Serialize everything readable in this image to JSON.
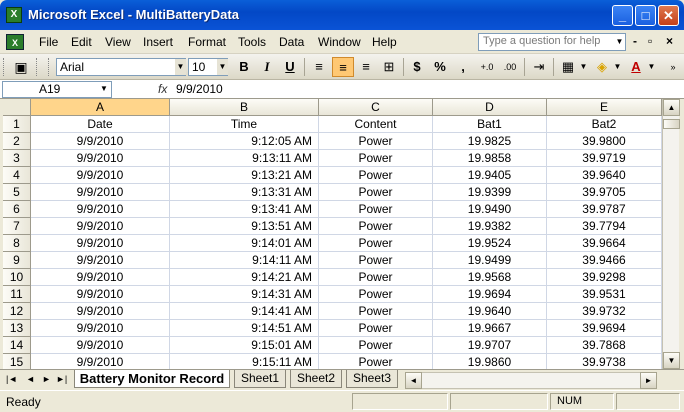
{
  "window": {
    "title": "Microsoft Excel - MultiBatteryData",
    "app_icon": "X",
    "min": "_",
    "max": "□",
    "close": "✕"
  },
  "menu": {
    "doc_icon": "X",
    "items": [
      "File",
      "Edit",
      "View",
      "Insert",
      "Format",
      "Tools",
      "Data",
      "Window",
      "Help"
    ],
    "help_placeholder": "Type a question for help",
    "doc_controls": [
      "-",
      "&#9645;",
      "×"
    ]
  },
  "toolbar": {
    "font": "Arial",
    "size": "10",
    "bold": "B",
    "italic": "I",
    "underline": "U",
    "currency": "$",
    "percent": "%",
    "comma": ",",
    "inc_decimal": "+.0",
    "dec_decimal": ".00",
    "font_color": "A"
  },
  "formula_bar": {
    "name_box": "A19",
    "fx": "fx",
    "value": "9/9/2010"
  },
  "sheet": {
    "columns": [
      "A",
      "B",
      "C",
      "D",
      "E"
    ],
    "selected_column": "A",
    "rows": [
      {
        "n": "1",
        "c": [
          "Date",
          "Time",
          "Content",
          "Bat1",
          "Bat2"
        ]
      },
      {
        "n": "2",
        "c": [
          "9/9/2010",
          "9:12:05 AM",
          "Power",
          "19.9825",
          "39.9800"
        ]
      },
      {
        "n": "3",
        "c": [
          "9/9/2010",
          "9:13:11 AM",
          "Power",
          "19.9858",
          "39.9719"
        ]
      },
      {
        "n": "4",
        "c": [
          "9/9/2010",
          "9:13:21 AM",
          "Power",
          "19.9405",
          "39.9640"
        ]
      },
      {
        "n": "5",
        "c": [
          "9/9/2010",
          "9:13:31 AM",
          "Power",
          "19.9399",
          "39.9705"
        ]
      },
      {
        "n": "6",
        "c": [
          "9/9/2010",
          "9:13:41 AM",
          "Power",
          "19.9490",
          "39.9787"
        ]
      },
      {
        "n": "7",
        "c": [
          "9/9/2010",
          "9:13:51 AM",
          "Power",
          "19.9382",
          "39.7794"
        ]
      },
      {
        "n": "8",
        "c": [
          "9/9/2010",
          "9:14:01 AM",
          "Power",
          "19.9524",
          "39.9664"
        ]
      },
      {
        "n": "9",
        "c": [
          "9/9/2010",
          "9:14:11 AM",
          "Power",
          "19.9499",
          "39.9466"
        ]
      },
      {
        "n": "10",
        "c": [
          "9/9/2010",
          "9:14:21 AM",
          "Power",
          "19.9568",
          "39.9298"
        ]
      },
      {
        "n": "11",
        "c": [
          "9/9/2010",
          "9:14:31 AM",
          "Power",
          "19.9694",
          "39.9531"
        ]
      },
      {
        "n": "12",
        "c": [
          "9/9/2010",
          "9:14:41 AM",
          "Power",
          "19.9640",
          "39.9732"
        ]
      },
      {
        "n": "13",
        "c": [
          "9/9/2010",
          "9:14:51 AM",
          "Power",
          "19.9667",
          "39.9694"
        ]
      },
      {
        "n": "14",
        "c": [
          "9/9/2010",
          "9:15:01 AM",
          "Power",
          "19.9707",
          "39.7868"
        ]
      },
      {
        "n": "15",
        "c": [
          "9/9/2010",
          "9:15:11 AM",
          "Power",
          "19.9860",
          "39.9738"
        ]
      }
    ]
  },
  "tabs": {
    "nav": [
      "|◄",
      "◄",
      "►",
      "►|"
    ],
    "sheets": [
      "Battery Monitor Record",
      "Sheet1",
      "Sheet2",
      "Sheet3"
    ],
    "active": 0
  },
  "status": {
    "ready": "Ready",
    "num": "NUM"
  }
}
